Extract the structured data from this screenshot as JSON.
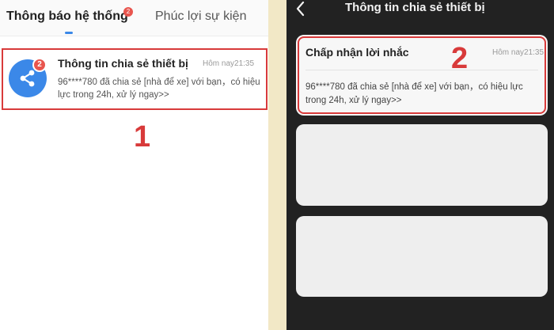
{
  "left_panel": {
    "tabs": [
      {
        "label": "Thông báo hệ thống",
        "badge": "2"
      },
      {
        "label": "Phúc lợi sự kiện"
      }
    ],
    "notification": {
      "title": "Thông tin chia sẻ thiết bị",
      "time": "Hôm nay21:35",
      "body": "96****780 đã chia sẻ [nhà để xe] với bạn，có hiệu lực trong 24h, xử lý ngay>>",
      "badge": "2",
      "icon": "share-icon"
    },
    "step_label": "1"
  },
  "right_panel": {
    "title": "Thông tin chia sẻ thiết bị",
    "back_icon": "chevron-left-icon",
    "accept_card": {
      "title": "Chấp nhận lời nhắc",
      "time": "Hôm nay21:35",
      "body": "96****780 đã chia sẻ [nhà để xe] với bạn，có hiệu lực trong 24h, xử lý ngay>>"
    },
    "step_label": "2"
  },
  "colors": {
    "accent_blue": "#3b88e8",
    "highlight_red": "#d83a3a",
    "badge_red": "#e8554e",
    "dark_background": "#222222"
  }
}
